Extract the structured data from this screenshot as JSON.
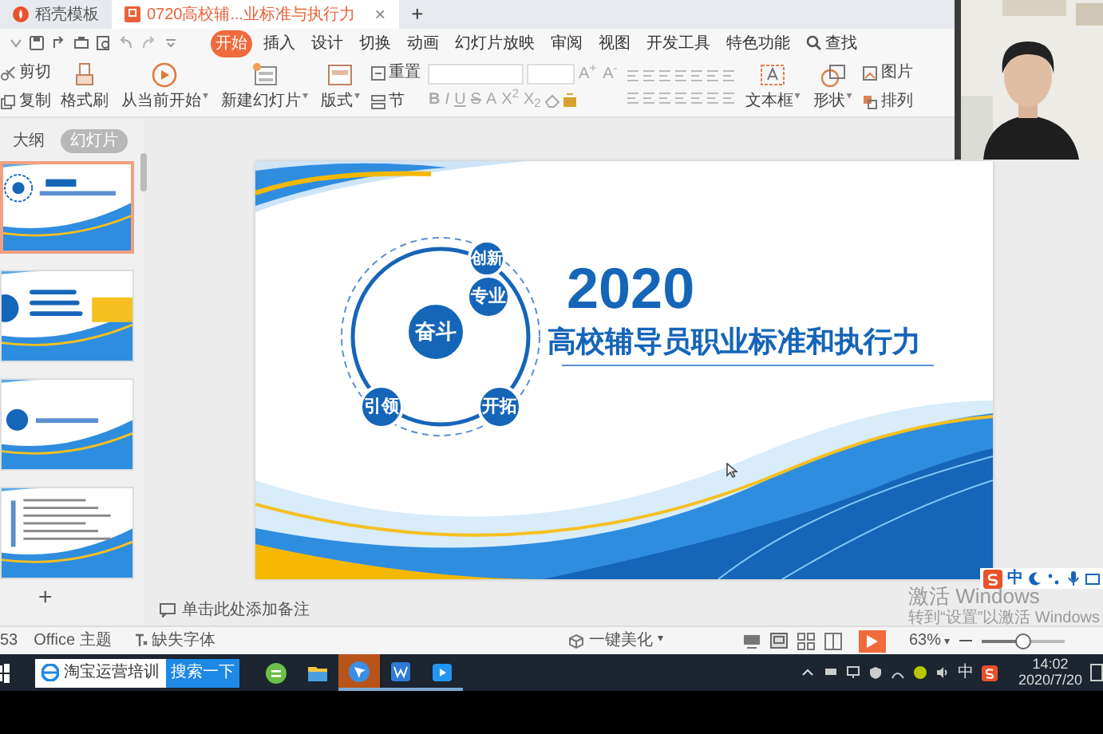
{
  "tabs": [
    {
      "label": "稻壳模板",
      "selected": false
    },
    {
      "label": "0720高校辅...业标准与执行力",
      "selected": true,
      "close": "×"
    }
  ],
  "new_tab": "+",
  "ribbon_tabs": [
    {
      "label": "开始",
      "selected": true
    },
    {
      "label": "插入",
      "selected": false
    },
    {
      "label": "设计",
      "selected": false
    },
    {
      "label": "切换",
      "selected": false
    },
    {
      "label": "动画",
      "selected": false
    },
    {
      "label": "幻灯片放映",
      "selected": false
    },
    {
      "label": "审阅",
      "selected": false
    },
    {
      "label": "视图",
      "selected": false
    },
    {
      "label": "开发工具",
      "selected": false
    },
    {
      "label": "特色功能",
      "selected": false
    }
  ],
  "search": "查找",
  "toolbar": [
    {
      "kind": "stack",
      "items": [
        "剪切",
        "复制"
      ]
    },
    {
      "kind": "big",
      "label": "格式刷"
    },
    {
      "kind": "big",
      "label": "从当前开始",
      "dropdown": "▾"
    },
    {
      "kind": "big",
      "label": "新建幻灯片",
      "dropdown": "▾"
    },
    {
      "kind": "big",
      "label": "版式",
      "dropdown": "▾"
    },
    {
      "kind": "stack",
      "items": [
        "重置",
        "节"
      ]
    },
    {
      "kind": "font",
      "size_buttons": [
        "A$^{+}$",
        "A$^{-}$"
      ],
      "format_buttons": [
        "B",
        "I",
        "U",
        "S",
        "A",
        "X$^{2}$",
        "X$_{2}$"
      ]
    },
    {
      "kind": "paragraph"
    },
    {
      "kind": "big",
      "label": "文本框",
      "dropdown": "▾"
    },
    {
      "kind": "big",
      "label": "形状",
      "dropdown": "▾"
    },
    {
      "kind": "stack",
      "items": [
        "图片",
        "排列"
      ]
    }
  ],
  "panel_tabs": [
    {
      "label": "大纲",
      "selected": false
    },
    {
      "label": "幻灯片",
      "selected": true
    }
  ],
  "thumbnails": [
    {
      "kind": "title",
      "selected": true
    },
    {
      "kind": "contents",
      "selected": false
    },
    {
      "kind": "section",
      "selected": false
    },
    {
      "kind": "text",
      "selected": false
    }
  ],
  "add_slide": "+",
  "slide": {
    "year": "2020",
    "title": "高校辅导员职业标准和执行力",
    "center": "奋斗",
    "nodes": [
      {
        "label": "创新",
        "kind": "tiny"
      },
      {
        "label": "专业",
        "kind": "mid"
      },
      {
        "label": "引领",
        "kind": "mid"
      },
      {
        "label": "开拓",
        "kind": "mid"
      }
    ]
  },
  "notes_placeholder": "单击此处添加备注",
  "status": {
    "slide_count": "53",
    "theme": "Office 主题",
    "missing_fonts": "缺失字体",
    "beautify": "一键美化",
    "beautify_dropdown": "▾",
    "zoom": "63%",
    "zoom_dropdown": "▾",
    "zoom_slider": {
      "level": 0.5
    }
  },
  "ime_bar": {
    "label": "中"
  },
  "activation": {
    "title": "激活 Windows",
    "subtitle": "转到“设置”以激活 Windows"
  },
  "taskbar": {
    "search_text": "淘宝运营培训",
    "search_button": "搜索一下",
    "apps": [
      {
        "kind": "chat",
        "active": false,
        "open": false
      },
      {
        "kind": "folder",
        "active": false,
        "open": false
      },
      {
        "kind": "pointer",
        "active": true,
        "open": true
      },
      {
        "kind": "wps",
        "active": false,
        "open": true
      },
      {
        "kind": "video",
        "active": false,
        "open": true
      }
    ],
    "ime": "中",
    "time": "14:02",
    "date": "2020/7/20"
  }
}
